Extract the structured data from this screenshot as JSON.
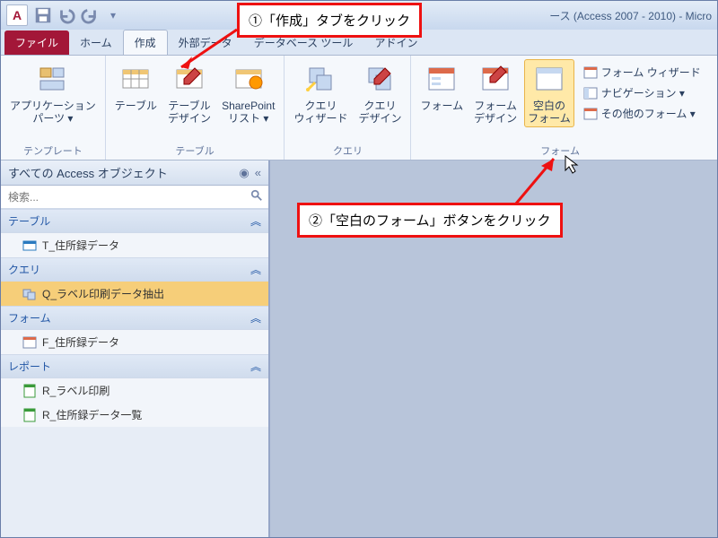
{
  "title_suffix": "ース (Access 2007 - 2010) - Micro",
  "tabs": {
    "file": "ファイル",
    "home": "ホーム",
    "create": "作成",
    "external": "外部データ",
    "dbtools": "データベース ツール",
    "addin": "アドイン"
  },
  "ribbon": {
    "groups": {
      "templates": {
        "label": "テンプレート",
        "app_parts": "アプリケーション\nパーツ ▾"
      },
      "tables": {
        "label": "テーブル",
        "table": "テーブル",
        "table_design": "テーブル\nデザイン",
        "sharepoint": "SharePoint\nリスト ▾"
      },
      "queries": {
        "label": "クエリ",
        "query_wizard": "クエリ\nウィザード",
        "query_design": "クエリ\nデザイン"
      },
      "forms": {
        "label": "フォーム",
        "form": "フォーム",
        "form_design": "フォーム\nデザイン",
        "blank_form": "空白の\nフォーム",
        "form_wizard": "フォーム ウィザード",
        "navigation": "ナビゲーション ▾",
        "other_forms": "その他のフォーム ▾"
      }
    }
  },
  "navpane": {
    "header": "すべての Access オブジェクト",
    "search_placeholder": "検索...",
    "groups": {
      "tables": "テーブル",
      "queries": "クエリ",
      "forms": "フォーム",
      "reports": "レポート"
    },
    "items": {
      "table1": "T_住所録データ",
      "query1": "Q_ラベル印刷データ抽出",
      "form1": "F_住所録データ",
      "report1": "R_ラベル印刷",
      "report2": "R_住所録データ一覧"
    }
  },
  "annotations": {
    "step1": "①「作成」タブをクリック",
    "step2": "②「空白のフォーム」ボタンをクリック"
  }
}
